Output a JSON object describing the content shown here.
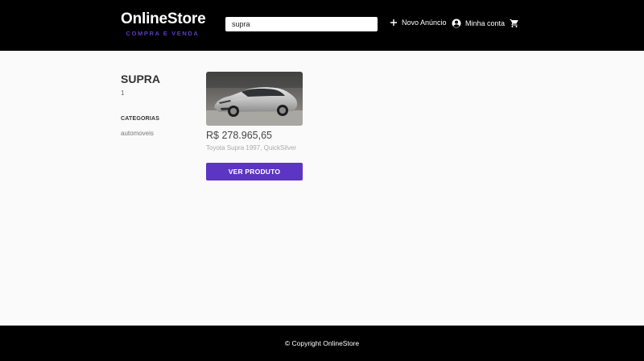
{
  "header": {
    "brand_name": "OnlineStore",
    "brand_tagline": "COMPRA E VENDA",
    "search_value": "supra",
    "new_ad_label": "Novo Anúncio",
    "account_label": "Minha conta"
  },
  "icons": {
    "new_ad": "plus-icon",
    "account": "account-circle-icon",
    "cart": "shopping-cart-icon"
  },
  "sidebar": {
    "search_title": "SUPRA",
    "result_count": "1",
    "categories_title": "CATEGORIAS",
    "categories": [
      "automoveis"
    ]
  },
  "products": [
    {
      "price": "R$ 278.965,65",
      "title": "Toyota Supra 1997, QuickSilver",
      "button_label": "VER PRODUTO"
    }
  ],
  "footer": {
    "copyright": "© Copyright OnlineStore"
  },
  "colors": {
    "header_bg": "#000000",
    "accent": "#5c35c4",
    "page_bg": "#fafafa"
  }
}
